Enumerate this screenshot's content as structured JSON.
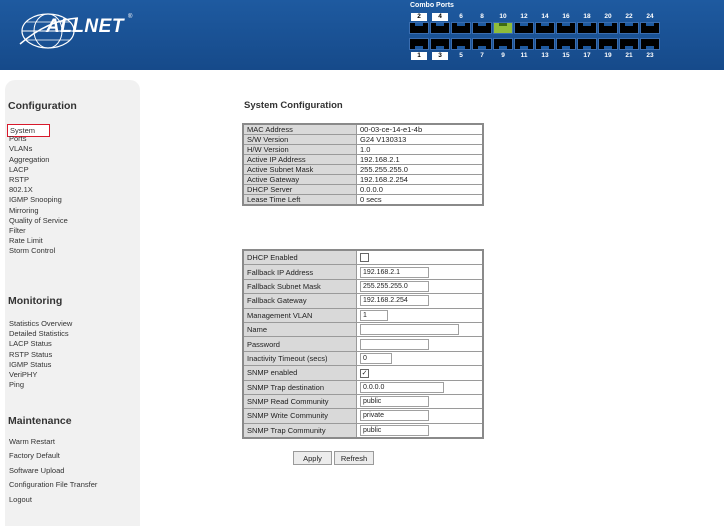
{
  "header": {
    "brand": "ALLNET",
    "registered": "®",
    "combo_label": "Combo Ports",
    "ports_top": [
      "2",
      "4",
      "6",
      "8",
      "10",
      "12",
      "14",
      "16",
      "18",
      "20",
      "22",
      "24"
    ],
    "ports_bottom": [
      "1",
      "3",
      "5",
      "7",
      "9",
      "11",
      "13",
      "15",
      "17",
      "19",
      "21",
      "23"
    ],
    "active_port": "10"
  },
  "sidebar": {
    "configuration": {
      "title": "Configuration",
      "items": [
        "System",
        "Ports",
        "VLANs",
        "Aggregation",
        "LACP",
        "RSTP",
        "802.1X",
        "IGMP Snooping",
        "Mirroring",
        "Quality of Service",
        "Filter",
        "Rate Limit",
        "Storm Control"
      ],
      "selected": "System"
    },
    "monitoring": {
      "title": "Monitoring",
      "items": [
        "Statistics Overview",
        "Detailed Statistics",
        "LACP Status",
        "RSTP Status",
        "IGMP Status",
        "VeriPHY",
        "Ping"
      ]
    },
    "maintenance": {
      "title": "Maintenance",
      "items": [
        "Warm Restart",
        "Factory Default",
        "Software Upload",
        "Configuration File Transfer",
        "Logout"
      ]
    }
  },
  "main": {
    "title": "System Configuration",
    "info": [
      {
        "label": "MAC Address",
        "value": "00-03-ce-14-e1-4b"
      },
      {
        "label": "S/W Version",
        "value": "G24 V130313"
      },
      {
        "label": "H/W Version",
        "value": "1.0"
      },
      {
        "label": "Active IP Address",
        "value": "192.168.2.1"
      },
      {
        "label": "Active Subnet Mask",
        "value": "255.255.255.0"
      },
      {
        "label": "Active Gateway",
        "value": "192.168.2.254"
      },
      {
        "label": "DHCP Server",
        "value": "0.0.0.0"
      },
      {
        "label": "Lease Time Left",
        "value": "0 secs"
      }
    ],
    "config": {
      "dhcp_enabled": {
        "label": "DHCP Enabled",
        "checked": false
      },
      "fallback_ip": {
        "label": "Fallback IP Address",
        "value": "192.168.2.1"
      },
      "fallback_mask": {
        "label": "Fallback Subnet Mask",
        "value": "255.255.255.0"
      },
      "fallback_gw": {
        "label": "Fallback Gateway",
        "value": "192.168.2.254"
      },
      "mgmt_vlan": {
        "label": "Management VLAN",
        "value": "1"
      },
      "name": {
        "label": "Name",
        "value": ""
      },
      "password": {
        "label": "Password",
        "value": ""
      },
      "inactivity": {
        "label": "Inactivity Timeout (secs)",
        "value": "0"
      },
      "snmp_enabled": {
        "label": "SNMP enabled",
        "checked": true,
        "mark": "✓"
      },
      "snmp_trap_dest": {
        "label": "SNMP Trap destination",
        "value": "0.0.0.0"
      },
      "snmp_read": {
        "label": "SNMP Read Community",
        "value": "public"
      },
      "snmp_write": {
        "label": "SNMP Write Community",
        "value": "private"
      },
      "snmp_trap_comm": {
        "label": "SNMP Trap Community",
        "value": "public"
      }
    },
    "buttons": {
      "apply": "Apply",
      "refresh": "Refresh"
    }
  }
}
